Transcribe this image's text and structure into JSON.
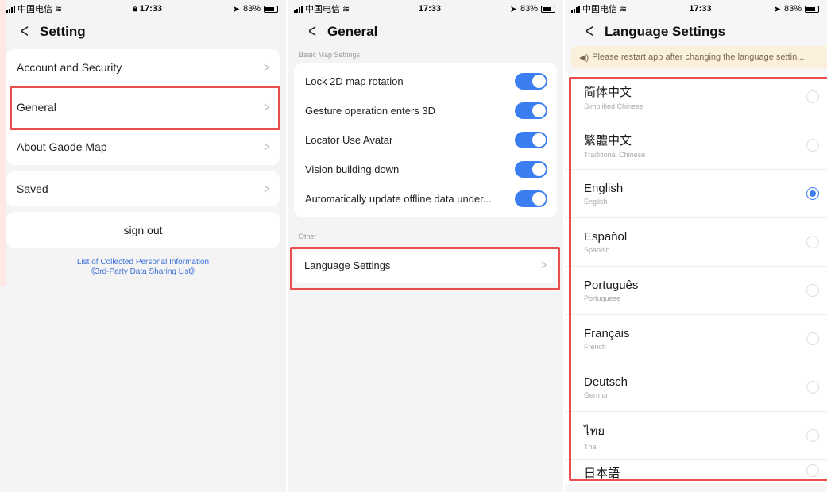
{
  "colors": {
    "accent": "#3b7ef0",
    "highlight": "#e94e4e",
    "link": "#3b6fd8",
    "notice_bg": "#fbf0dc"
  },
  "status_bar": {
    "carrier": "中国电信",
    "battery": "83%"
  },
  "screen1": {
    "time": "17:33",
    "title": "Setting",
    "items": [
      {
        "label": "Account and Security"
      },
      {
        "label": "General"
      },
      {
        "label": "About Gaode Map"
      },
      {
        "label": "Saved"
      }
    ],
    "sign_out": "sign out",
    "link1": "List of Collected Personal Information",
    "link2": "《3rd-Party Data Sharing List》"
  },
  "screen2": {
    "time": "17:33",
    "title": "General",
    "section1": "Basic Map Settings",
    "toggles": [
      {
        "label": "Lock 2D map rotation",
        "on": true
      },
      {
        "label": "Gesture operation enters 3D",
        "on": true
      },
      {
        "label": "Locator Use Avatar",
        "on": true
      },
      {
        "label": "Vision building down",
        "on": true
      },
      {
        "label": "Automatically update offline data under...",
        "on": true
      }
    ],
    "section2": "Other",
    "language_item": "Language Settings"
  },
  "screen3": {
    "time": "17:33",
    "title": "Language Settings",
    "notice": "Please restart app after changing the language settin...",
    "languages": [
      {
        "native": "简体中文",
        "english": "Simplified Chinese",
        "selected": false
      },
      {
        "native": "繁體中文",
        "english": "Traditional Chinese",
        "selected": false
      },
      {
        "native": "English",
        "english": "English",
        "selected": true
      },
      {
        "native": "Español",
        "english": "Spanish",
        "selected": false
      },
      {
        "native": "Português",
        "english": "Portuguese",
        "selected": false
      },
      {
        "native": "Français",
        "english": "French",
        "selected": false
      },
      {
        "native": "Deutsch",
        "english": "German",
        "selected": false
      },
      {
        "native": "ไทย",
        "english": "Thai",
        "selected": false
      },
      {
        "native": "日本語",
        "english": "",
        "selected": false
      }
    ]
  }
}
